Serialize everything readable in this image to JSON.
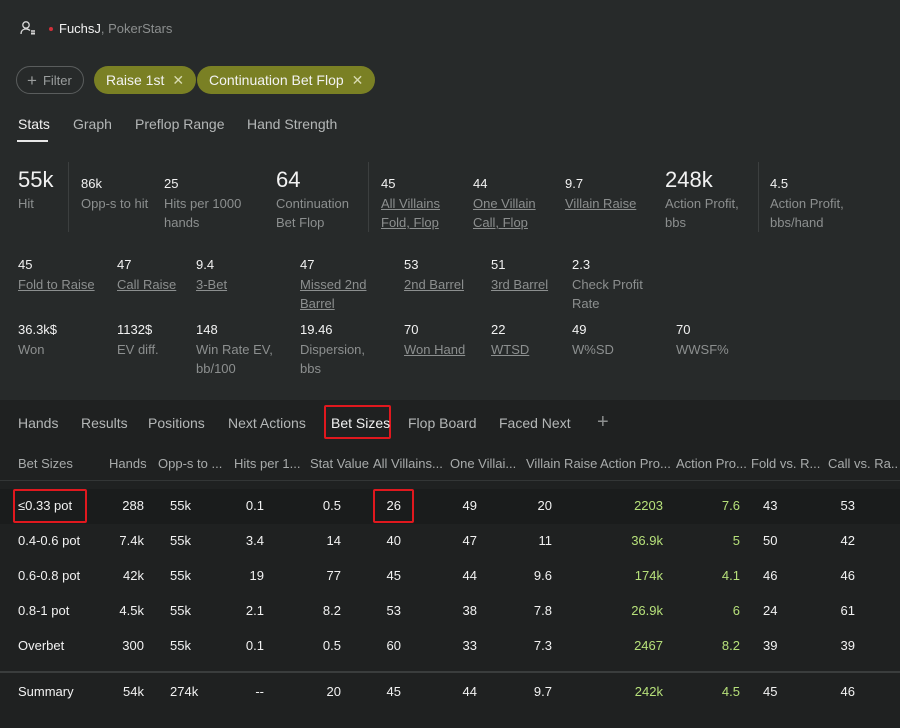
{
  "header": {
    "player": "FuchsJ",
    "site": ", PokerStars"
  },
  "filters": {
    "add_label": "Filter",
    "chips": [
      "Raise 1st",
      "Continuation Bet Flop"
    ]
  },
  "top_tabs": [
    "Stats",
    "Graph",
    "Preflop Range",
    "Hand Strength"
  ],
  "stats": {
    "row1": {
      "hit": {
        "value": "55k",
        "label": "Hit"
      },
      "opps": {
        "value": "86k",
        "label": "Opp-s to hit"
      },
      "hits_per": {
        "value": "25",
        "label1": "Hits per 1000",
        "label2": "hands"
      },
      "cbet": {
        "value": "64",
        "label1": "Continuation",
        "label2": "Bet Flop"
      },
      "all_villains": {
        "value": "45",
        "label1": "All Villains",
        "label2": "Fold, Flop"
      },
      "one_villain": {
        "value": "44",
        "label1": "One Villain",
        "label2": "Call, Flop"
      },
      "villain_raise": {
        "value": "9.7",
        "label": "Villain Raise"
      },
      "action_profit": {
        "value": "248k",
        "label1": "Action Profit,",
        "label2": "bbs"
      },
      "action_profit_hand": {
        "value": "4.5",
        "label1": "Action Profit,",
        "label2": "bbs/hand"
      }
    },
    "row2": {
      "fold_to_raise": {
        "value": "45",
        "label": "Fold to Raise"
      },
      "call_raise": {
        "value": "47",
        "label": "Call Raise"
      },
      "three_bet": {
        "value": "9.4",
        "label": "3-Bet"
      },
      "missed_2nd": {
        "value": "47",
        "label1": "Missed 2nd",
        "label2": "Barrel"
      },
      "second_barrel": {
        "value": "53",
        "label": "2nd Barrel"
      },
      "third_barrel": {
        "value": "51",
        "label": "3rd Barrel"
      },
      "check_profit": {
        "value": "2.3",
        "label1": "Check Profit",
        "label2": "Rate"
      }
    },
    "row3": {
      "won": {
        "value": "36.3k$",
        "label": "Won"
      },
      "ev_diff": {
        "value": "1132$",
        "label": "EV diff."
      },
      "win_rate": {
        "value": "148",
        "label1": "Win Rate EV,",
        "label2": "bb/100"
      },
      "dispersion": {
        "value": "19.46",
        "label1": "Dispersion,",
        "label2": "bbs"
      },
      "won_hand": {
        "value": "70",
        "label": "Won Hand"
      },
      "wtsd": {
        "value": "22",
        "label": "WTSD"
      },
      "wsd": {
        "value": "49",
        "label": "W%SD"
      },
      "wwsf": {
        "value": "70",
        "label": "WWSF%"
      }
    }
  },
  "lower_tabs": [
    "Hands",
    "Results",
    "Positions",
    "Next Actions",
    "Bet Sizes",
    "Flop Board",
    "Faced Next"
  ],
  "table": {
    "columns": [
      "Bet Sizes",
      "Hands",
      "Opp-s to ...",
      "Hits per 1...",
      "Stat Value",
      "All Villains...",
      "One Villai...",
      "Villain Raise",
      "Action Pro...",
      "Action Pro...",
      "Fold vs. R...",
      "Call vs. Ra..."
    ],
    "rows": [
      [
        "≤0.33 pot",
        "288",
        "55k",
        "0.1",
        "0.5",
        "26",
        "49",
        "20",
        "2203",
        "7.6",
        "43",
        "53"
      ],
      [
        "0.4-0.6 pot",
        "7.4k",
        "55k",
        "3.4",
        "14",
        "40",
        "47",
        "11",
        "36.9k",
        "5",
        "50",
        "42"
      ],
      [
        "0.6-0.8 pot",
        "42k",
        "55k",
        "19",
        "77",
        "45",
        "44",
        "9.6",
        "174k",
        "4.1",
        "46",
        "46"
      ],
      [
        "0.8-1 pot",
        "4.5k",
        "55k",
        "2.1",
        "8.2",
        "53",
        "38",
        "7.8",
        "26.9k",
        "6",
        "24",
        "61"
      ],
      [
        "Overbet",
        "300",
        "55k",
        "0.1",
        "0.5",
        "60",
        "33",
        "7.3",
        "2467",
        "8.2",
        "39",
        "39"
      ]
    ],
    "summary": [
      "Summary",
      "54k",
      "274k",
      "--",
      "20",
      "45",
      "44",
      "9.7",
      "242k",
      "4.5",
      "45",
      "46"
    ]
  },
  "colors": {
    "chip": "#7a8024",
    "positive": "#b6e07a",
    "highlight_box": "#e0181e",
    "background": "#272a2a"
  }
}
